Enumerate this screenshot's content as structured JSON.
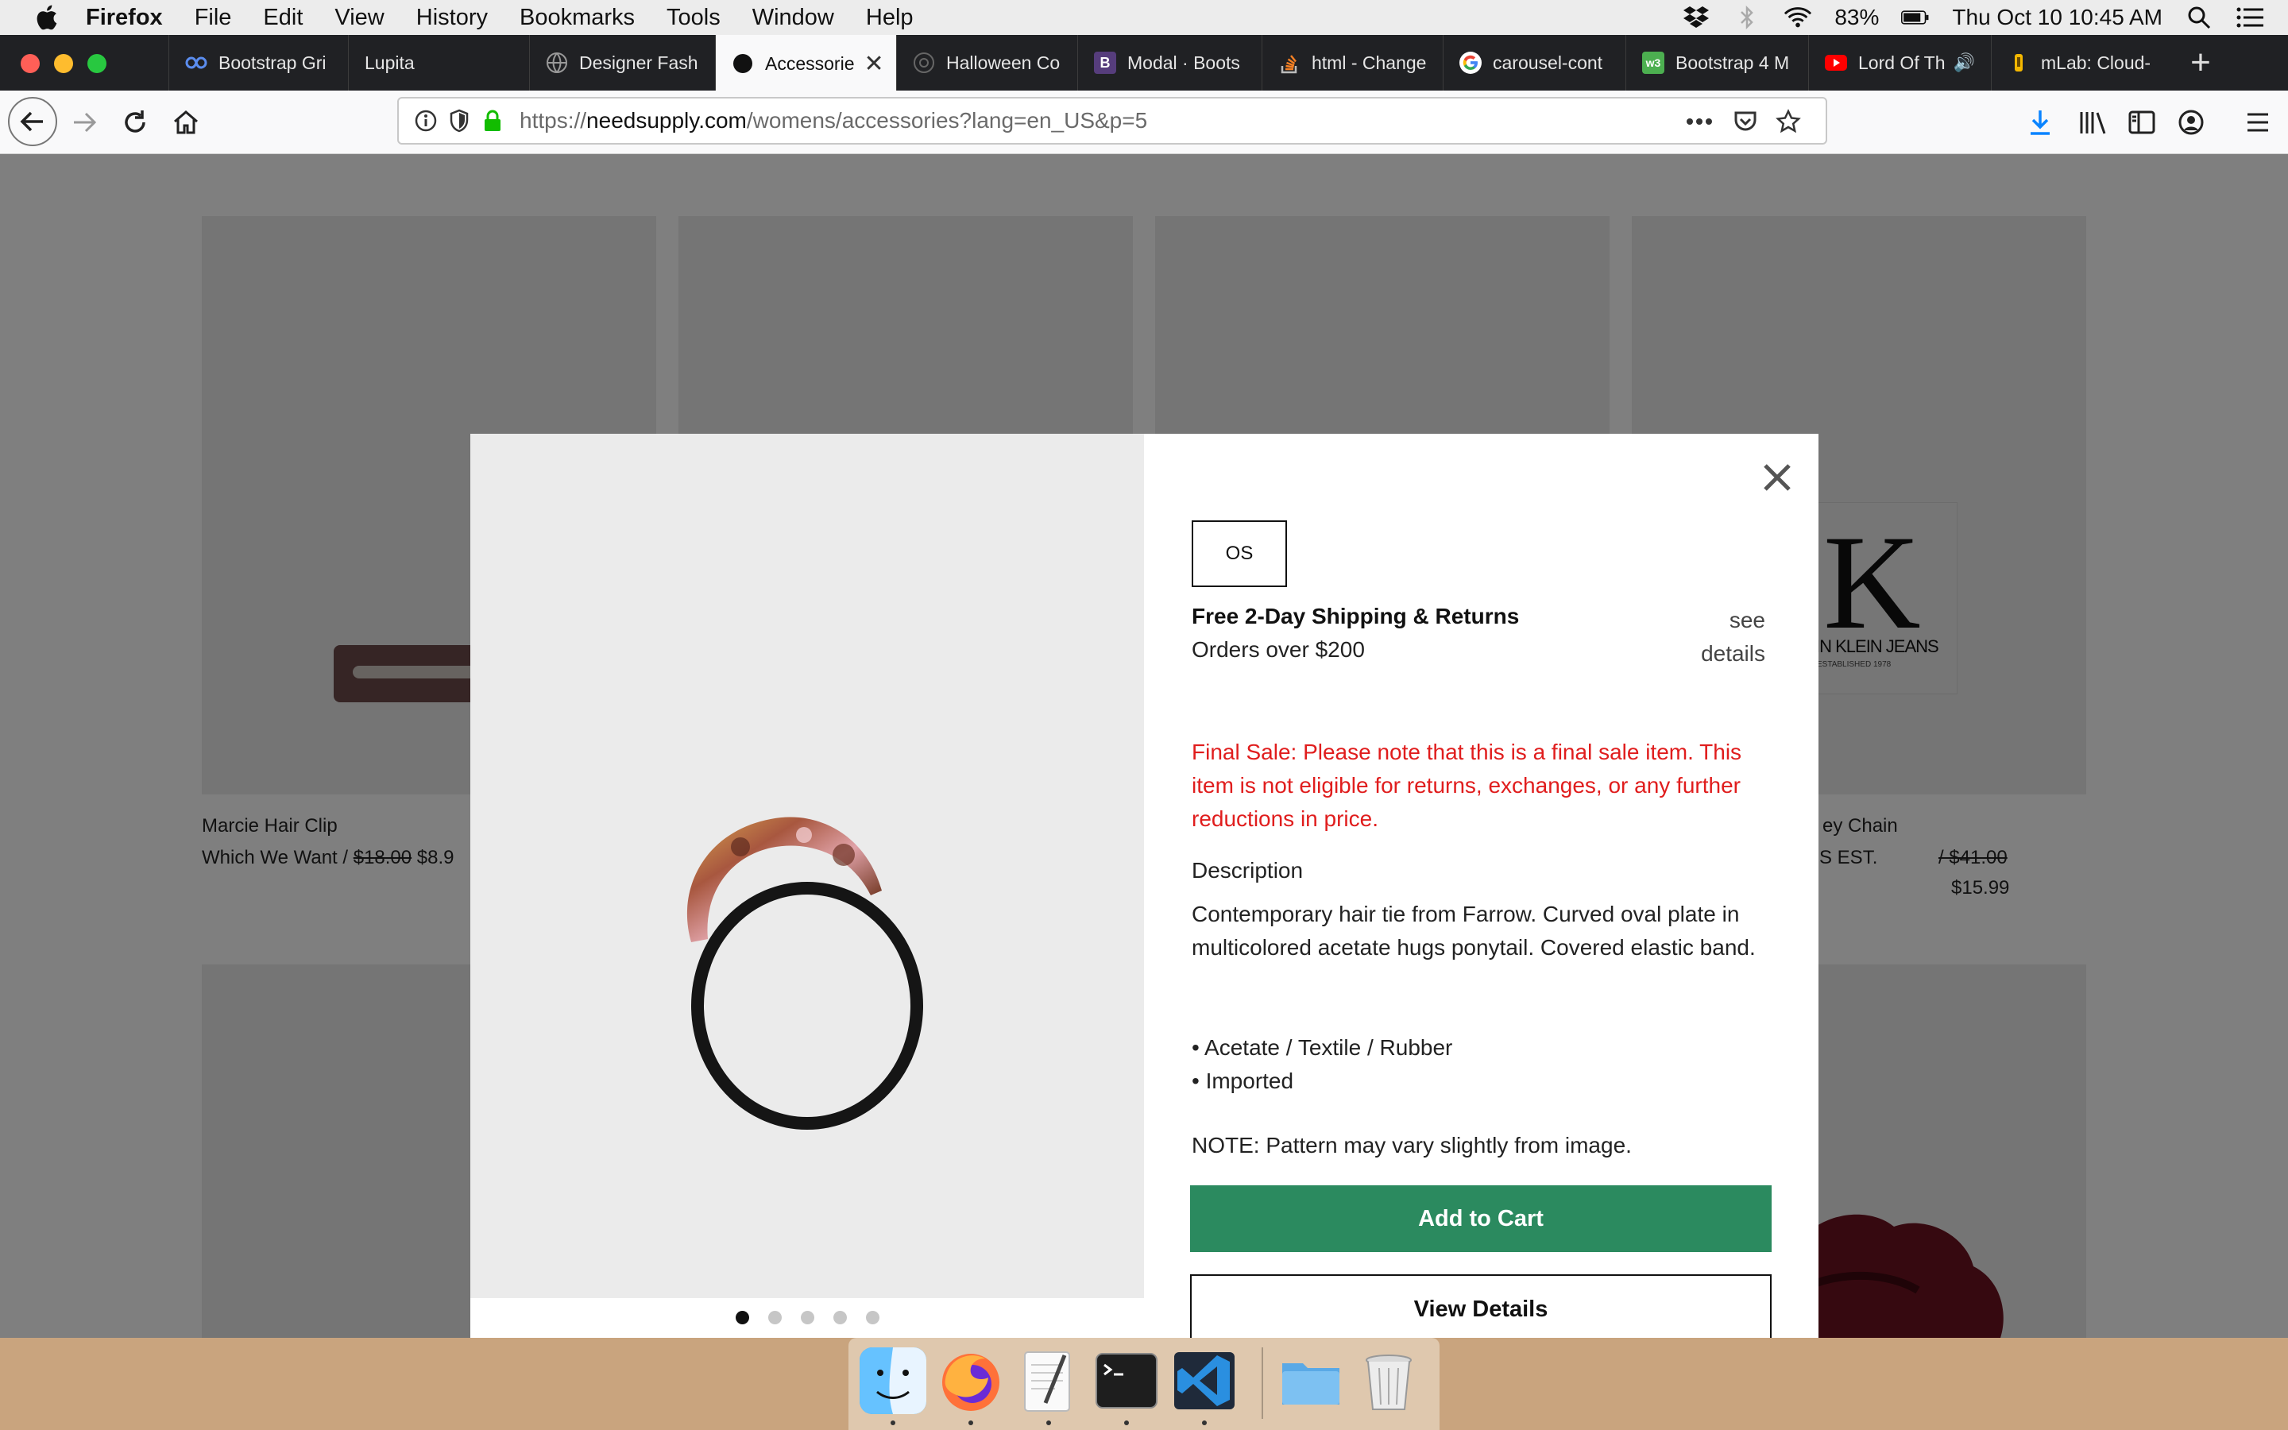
{
  "menubar": {
    "app_name": "Firefox",
    "items": [
      "File",
      "Edit",
      "View",
      "History",
      "Bookmarks",
      "Tools",
      "Window",
      "Help"
    ],
    "battery": "83%",
    "clock": "Thu Oct 10  10:45 AM"
  },
  "tabs": [
    {
      "label": "Bootstrap Gri",
      "icon": "bootstrap-grid-icon",
      "color": "#5b8def"
    },
    {
      "label": "Lupita",
      "icon": "",
      "color": ""
    },
    {
      "label": "Designer Fash",
      "icon": "globe-icon",
      "color": "#888888"
    },
    {
      "label": "Accessorie",
      "icon": "needsupply-icon",
      "color": "#111111",
      "active": true
    },
    {
      "label": "Halloween Co",
      "icon": "globe-icon",
      "color": "#666666"
    },
    {
      "label": "Modal · Boots",
      "icon": "bootstrap-icon",
      "color": "#563d7c",
      "glyph": "B"
    },
    {
      "label": "html - Change",
      "icon": "stackoverflow-icon",
      "color": "#f48024"
    },
    {
      "label": "carousel-cont",
      "icon": "google-icon",
      "color": "#4285f4"
    },
    {
      "label": "Bootstrap 4 M",
      "icon": "w3schools-icon",
      "color": "#4caf50",
      "glyph": "w3"
    },
    {
      "label": "Lord Of Th",
      "icon": "youtube-icon",
      "color": "#ff0000"
    },
    {
      "label": "mLab: Cloud-",
      "icon": "mlab-icon",
      "color": "#f5b800"
    }
  ],
  "url": {
    "prefix": "https://",
    "host": "needsupply.com",
    "path": "/womens/accessories?lang=en_US&p=5"
  },
  "background_products": [
    {
      "name": "Marcie Hair Clip",
      "brand": "Which We Want / ",
      "old_price": "$18.00",
      "price": "$8.9"
    },
    {
      "name": "ey Chain",
      "brand": "S EST.",
      "old_price": "/ $41.00",
      "price": "$15.99"
    }
  ],
  "bg_logo_text": {
    "main": "K",
    "sub": "IN KLEIN JEANS",
    "tiny": "ESTABLISHED 1978"
  },
  "modal": {
    "size_option": "OS",
    "shipping_title": "Free 2-Day Shipping & Returns",
    "shipping_sub": "Orders over $200",
    "see_details": "see details",
    "final_sale": "Final Sale: Please note that this is a final sale item. This item is not eligible for returns, exchanges, or any further reductions in price.",
    "description_heading": "Description",
    "description_body": "Contemporary hair tie from Farrow. Curved oval plate in multicolored acetate hugs ponytail. Covered elastic band.",
    "bullets": [
      "• Acetate / Textile / Rubber",
      "• Imported"
    ],
    "note": "NOTE: Pattern may vary slightly from image.",
    "add_to_cart": "Add to Cart",
    "view_details": "View Details",
    "carousel_count": 5,
    "carousel_active": 1
  },
  "colors": {
    "accent_green": "#2b8a5f",
    "final_sale_red": "#e01d1d",
    "download_blue": "#0a84ff"
  }
}
